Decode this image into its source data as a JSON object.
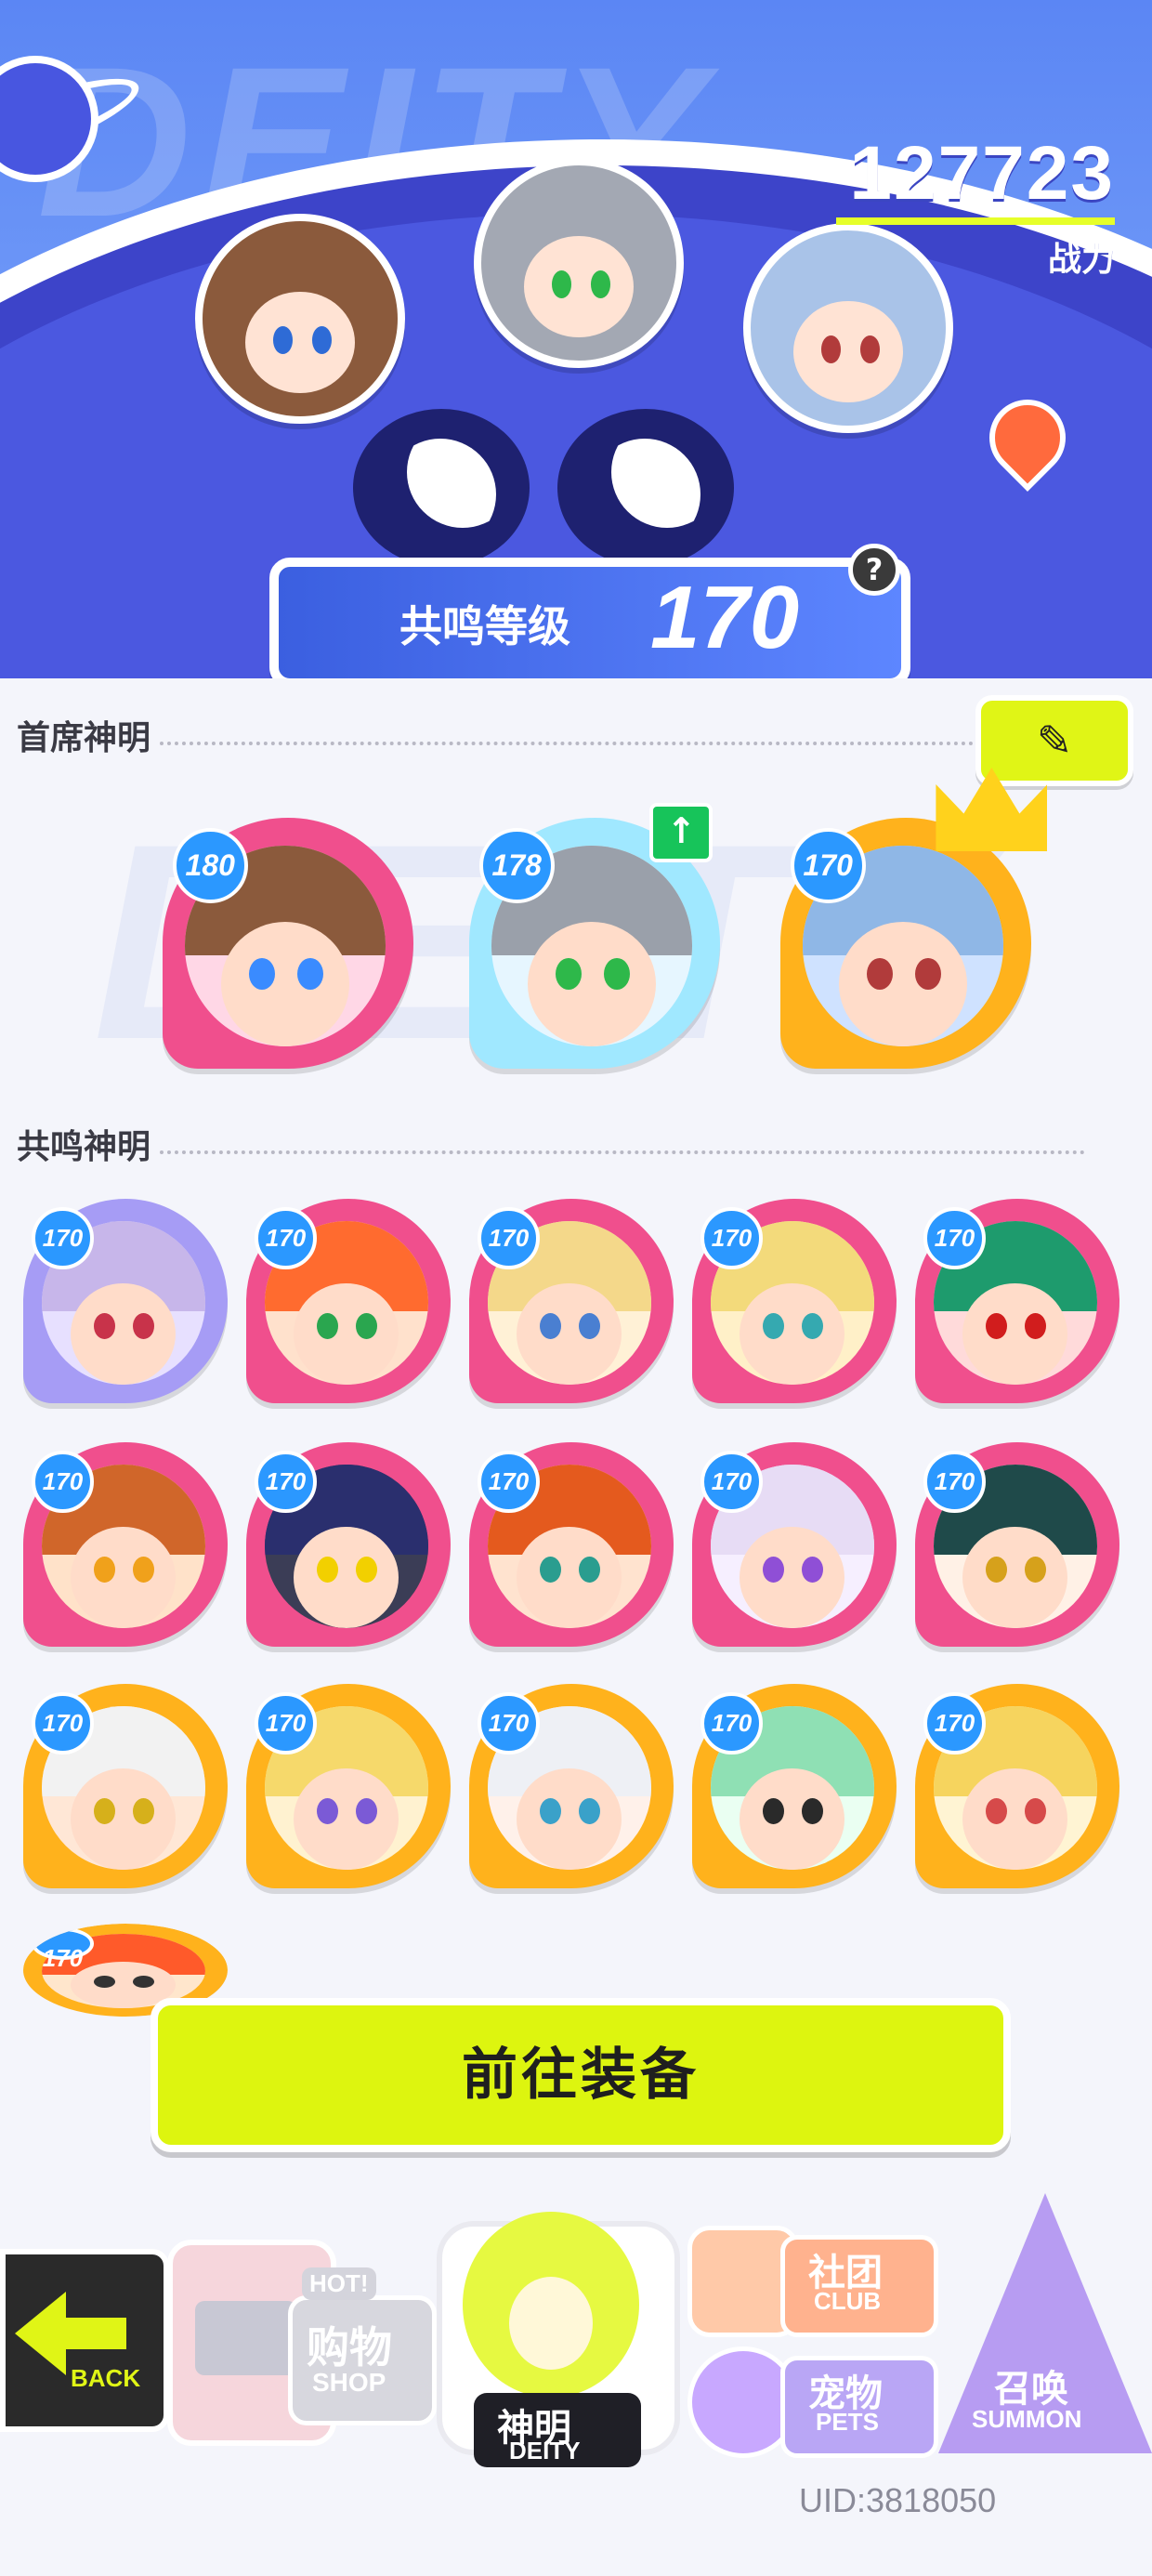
{
  "header": {
    "watermark": "DEITY",
    "combat_power": {
      "value": "127723",
      "label": "战力"
    },
    "resonance": {
      "label": "共鸣等级",
      "value": "170"
    },
    "help_glyph": "?"
  },
  "sections": {
    "chief": {
      "title": "首席神明",
      "edit_glyph": "✎"
    },
    "resonant": {
      "title": "共鸣神明"
    }
  },
  "chief_deities": [
    {
      "level": "180",
      "ring": "#f04f8d",
      "hair": "#8b5a3c",
      "eye": "#3a8bff",
      "inner": "#ffd7e6"
    },
    {
      "level": "178",
      "ring": "#a0e8ff",
      "hair": "#9aa0aa",
      "eye": "#2eb84a",
      "inner": "#e6f6ff"
    },
    {
      "level": "170",
      "ring": "#ffb21c",
      "hair": "#8fb7e6",
      "eye": "#b13b3b",
      "inner": "#cfe2ff"
    }
  ],
  "resonant_deities": [
    {
      "level": "170",
      "ring": "#a69cf5",
      "hair": "#c7b6ea",
      "eye": "#c8334a",
      "inner": "#e7e0ff"
    },
    {
      "level": "170",
      "ring": "#f04f8d",
      "hair": "#ff6b2f",
      "eye": "#2aa64f",
      "inner": "#ffe1cc"
    },
    {
      "level": "170",
      "ring": "#f04f8d",
      "hair": "#f4d88a",
      "eye": "#4a7fd1",
      "inner": "#fff1d6"
    },
    {
      "level": "170",
      "ring": "#f04f8d",
      "hair": "#f3da7b",
      "eye": "#35a9b0",
      "inner": "#fff0c8"
    },
    {
      "level": "170",
      "ring": "#f04f8d",
      "hair": "#1e9b6d",
      "eye": "#d11d1d",
      "inner": "#ffdada"
    },
    {
      "level": "170",
      "ring": "#f04f8d",
      "hair": "#d0662a",
      "eye": "#f0a11b",
      "inner": "#ffe2c9"
    },
    {
      "level": "170",
      "ring": "#f04f8d",
      "hair": "#2a2f6e",
      "eye": "#f2d000",
      "inner": "#3b3d56"
    },
    {
      "level": "170",
      "ring": "#f04f8d",
      "hair": "#e45a1e",
      "eye": "#2a9d8f",
      "inner": "#ffe3cf"
    },
    {
      "level": "170",
      "ring": "#f04f8d",
      "hair": "#e7dcf5",
      "eye": "#8f4fd6",
      "inner": "#f6efff"
    },
    {
      "level": "170",
      "ring": "#f04f8d",
      "hair": "#1f4a4a",
      "eye": "#d6a11b",
      "inner": "#fff1e6"
    },
    {
      "level": "170",
      "ring": "#ffb21c",
      "hair": "#f2f2f2",
      "eye": "#d6b01b",
      "inner": "#ffe7d6"
    },
    {
      "level": "170",
      "ring": "#ffb21c",
      "hair": "#f6d96b",
      "eye": "#7b5ad6",
      "inner": "#fff2d0"
    },
    {
      "level": "170",
      "ring": "#ffb21c",
      "hair": "#eef0f5",
      "eye": "#3aa1c9",
      "inner": "#fff1ea"
    },
    {
      "level": "170",
      "ring": "#ffb21c",
      "hair": "#8fe0b4",
      "eye": "#2a2a2a",
      "inner": "#eafff2"
    },
    {
      "level": "170",
      "ring": "#ffb21c",
      "hair": "#f6d45e",
      "eye": "#d64a4a",
      "inner": "#fff4d3"
    },
    {
      "level": "170",
      "ring": "#ffb21c",
      "hair": "#ff5a2a",
      "eye": "#333",
      "inner": "#ffe6cc"
    }
  ],
  "equip_button": {
    "label": "前往装备"
  },
  "nav": {
    "back": {
      "label": "BACK"
    },
    "shop": {
      "label_cn": "购物",
      "label_en": "SHOP",
      "badge": "HOT!"
    },
    "deity": {
      "label_cn": "神明",
      "label_en": "DEITY"
    },
    "club": {
      "label_cn": "社团",
      "label_en": "CLUB"
    },
    "pets": {
      "label_cn": "宠物",
      "label_en": "PETS"
    },
    "summon": {
      "label_cn": "召唤",
      "label_en": "SUMMON"
    }
  },
  "uid": "UID:3818050",
  "colors": {
    "accent_yellow": "#ddf50f",
    "header_blue": "#5b86f4",
    "pink_ring": "#f04f8d",
    "gold_ring": "#ffb21c"
  }
}
